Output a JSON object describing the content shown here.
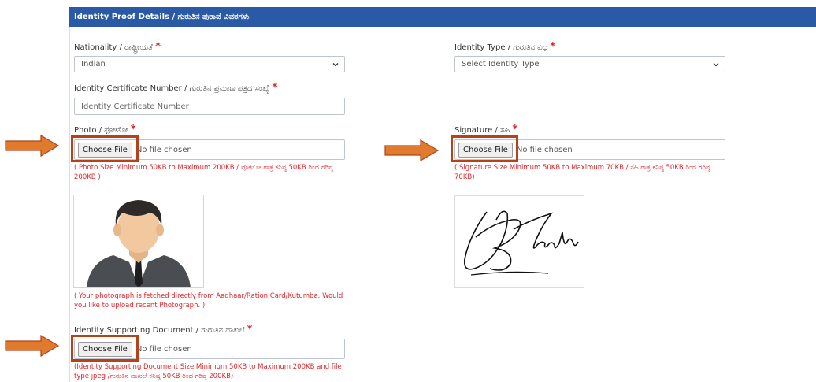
{
  "header": {
    "title": "Identity Proof Details / ಗುರುತಿನ ಪುರಾವೆ ವಿವರಗಳು"
  },
  "nationality": {
    "label": "Nationality / ರಾಷ್ಟ್ರೀಯತೆ",
    "required": "*",
    "value": "Indian"
  },
  "identity_type": {
    "label": "Identity Type / ಗುರುತಿನ ವಿಧ",
    "required": "*",
    "value": "Select Identity Type"
  },
  "certificate_number": {
    "label": "Identity Certificate Number / ಗುರುತಿನ ಪ್ರಮಾಣ ಪತ್ರದ ಸಂಖ್ಯೆ",
    "required": "*",
    "placeholder": "Identity Certificate Number"
  },
  "photo": {
    "label": "Photo / ಫೋಟೋ",
    "required": "*",
    "button": "Choose File",
    "status": "No file chosen",
    "size_note": "( Photo Size Minimum 50KB to Maximum 200KB / ಫೋಟೋ ಗಾತ್ರ ಕನಿಷ್ಠ 50KB ರಿಂದ ಗರಿಷ್ಠ 200KB )",
    "fetched_note": "( Your photograph is fetched directly from Aadhaar/Ration Card/Kutumba. Would you like to upload recent Photograph. )"
  },
  "signature": {
    "label": "Signature / ಸಹಿ",
    "required": "*",
    "button": "Choose File",
    "status": "No file chosen",
    "size_note": "( Signature Size Minimum 50KB to Maximum 70KB / ಸಹಿ ಗಾತ್ರ ಕನಿಷ್ಠ 50KB ರಿಂದ ಗರಿಷ್ಠ 70KB)"
  },
  "supporting_document": {
    "label": "Identity Supporting Document / ಗುರುತಿನ ದಾಖಲೆ",
    "required": "*",
    "button": "Choose File",
    "status": "No file chosen",
    "size_note": "(Identity Supporting Document Size Minimum 50KB to Maximum 200KB and file type jpeg /ಗುರುತಿನ ದಾಖಲೆ ಕನಿಷ್ಠ 50KB ರಿಂದ ಗರಿಷ್ಠ 200KB)"
  },
  "colors": {
    "header_bg": "#2a5aa5",
    "required": "#e0262b",
    "highlight": "#b5431a",
    "arrow": "#e07a2c"
  }
}
